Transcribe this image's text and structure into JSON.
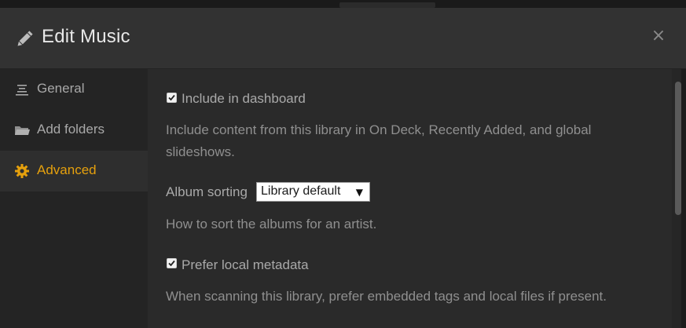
{
  "modal": {
    "title": "Edit Music",
    "close_label": "×"
  },
  "sidebar": {
    "items": [
      {
        "label": "General",
        "icon": "list-lines-icon",
        "active": false
      },
      {
        "label": "Add folders",
        "icon": "folder-icon",
        "active": false
      },
      {
        "label": "Advanced",
        "icon": "gear-icon",
        "active": true
      }
    ]
  },
  "settings": {
    "include_dashboard": {
      "label": "Include in dashboard",
      "checked": true,
      "help": "Include content from this library in On Deck, Recently Added, and global slideshows."
    },
    "album_sorting": {
      "label": "Album sorting",
      "value": "Library default",
      "help": "How to sort the albums for an artist."
    },
    "prefer_local_metadata": {
      "label": "Prefer local metadata",
      "checked": true,
      "help": "When scanning this library, prefer embedded tags and local files if present."
    }
  },
  "colors": {
    "accent": "#e5a00d",
    "header_bg": "#323232",
    "content_bg": "#2a2a2a"
  }
}
